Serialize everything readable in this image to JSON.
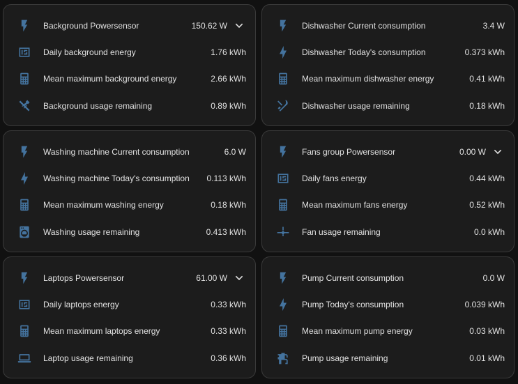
{
  "cards": [
    {
      "rows": [
        {
          "icon": "flash-icon",
          "label": "Background Powersensor",
          "value": "150.62 W",
          "expandable": true
        },
        {
          "icon": "meter-icon",
          "label": "Daily background energy",
          "value": "1.76 kWh"
        },
        {
          "icon": "calculator-icon",
          "label": "Mean maximum background energy",
          "value": "2.66 kWh"
        },
        {
          "icon": "tools-icon",
          "label": "Background usage remaining",
          "value": "0.89 kWh"
        }
      ]
    },
    {
      "rows": [
        {
          "icon": "flash-icon",
          "label": "Dishwasher Current consumption",
          "value": "3.4 W"
        },
        {
          "icon": "lightning-bolt-icon",
          "label": "Dishwasher Today's consumption",
          "value": "0.373 kWh"
        },
        {
          "icon": "calculator-icon",
          "label": "Mean maximum dishwasher energy",
          "value": "0.41 kWh"
        },
        {
          "icon": "silverware-clean-icon",
          "label": "Dishwasher usage remaining",
          "value": "0.18 kWh"
        }
      ]
    },
    {
      "rows": [
        {
          "icon": "flash-icon",
          "label": "Washing machine Current consumption",
          "value": "6.0 W"
        },
        {
          "icon": "lightning-bolt-icon",
          "label": "Washing machine Today's consumption",
          "value": "0.113 kWh"
        },
        {
          "icon": "calculator-icon",
          "label": "Mean maximum washing energy",
          "value": "0.18 kWh"
        },
        {
          "icon": "washing-machine-icon",
          "label": "Washing usage remaining",
          "value": "0.413 kWh"
        }
      ]
    },
    {
      "rows": [
        {
          "icon": "flash-icon",
          "label": "Fans group Powersensor",
          "value": "0.00 W",
          "expandable": true
        },
        {
          "icon": "meter-icon",
          "label": "Daily fans energy",
          "value": "0.44 kWh"
        },
        {
          "icon": "calculator-icon",
          "label": "Mean maximum fans energy",
          "value": "0.52 kWh"
        },
        {
          "icon": "ceiling-fan-icon",
          "label": "Fan usage remaining",
          "value": "0.0 kWh"
        }
      ]
    },
    {
      "rows": [
        {
          "icon": "flash-icon",
          "label": "Laptops Powersensor",
          "value": "61.00 W",
          "expandable": true
        },
        {
          "icon": "meter-icon",
          "label": "Daily laptops energy",
          "value": "0.33 kWh"
        },
        {
          "icon": "calculator-icon",
          "label": "Mean maximum laptops energy",
          "value": "0.33 kWh"
        },
        {
          "icon": "laptop-icon",
          "label": "Laptop usage remaining",
          "value": "0.36 kWh"
        }
      ]
    },
    {
      "rows": [
        {
          "icon": "flash-icon",
          "label": "Pump Current consumption",
          "value": "0.0 W"
        },
        {
          "icon": "lightning-bolt-icon",
          "label": "Pump Today's consumption",
          "value": "0.039 kWh"
        },
        {
          "icon": "calculator-icon",
          "label": "Mean maximum pump energy",
          "value": "0.03 kWh"
        },
        {
          "icon": "pump-icon",
          "label": "Pump usage remaining",
          "value": "0.01 kWh"
        }
      ]
    }
  ],
  "colors": {
    "background": "#111111",
    "card": "#1c1c1c",
    "icon": "#44739e",
    "text": "#e1e1e1"
  }
}
